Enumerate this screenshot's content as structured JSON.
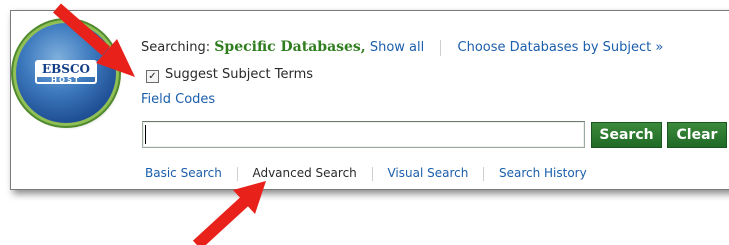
{
  "logo": {
    "brand": "EBSCO",
    "sub": "HOST"
  },
  "searching": {
    "label": "Searching:",
    "databases": "Specific Databases,",
    "show_all": "Show all",
    "choose_subject": "Choose Databases by Subject »"
  },
  "suggest": {
    "label": "Suggest Subject Terms",
    "checked": true
  },
  "field_codes": "Field Codes",
  "search": {
    "value": "",
    "search_label": "Search",
    "clear_label": "Clear"
  },
  "nav": {
    "basic": "Basic Search",
    "advanced": "Advanced Search",
    "visual": "Visual Search",
    "history": "Search History"
  },
  "colors": {
    "accent_green": "#2f7d1f",
    "button_green": "#1f6a26",
    "link_blue": "#1b5eab",
    "arrow_red": "#e8211a"
  },
  "icons": [
    "arrow-annotation-icon",
    "checkbox-checked-icon",
    "ebsco-host-logo"
  ]
}
